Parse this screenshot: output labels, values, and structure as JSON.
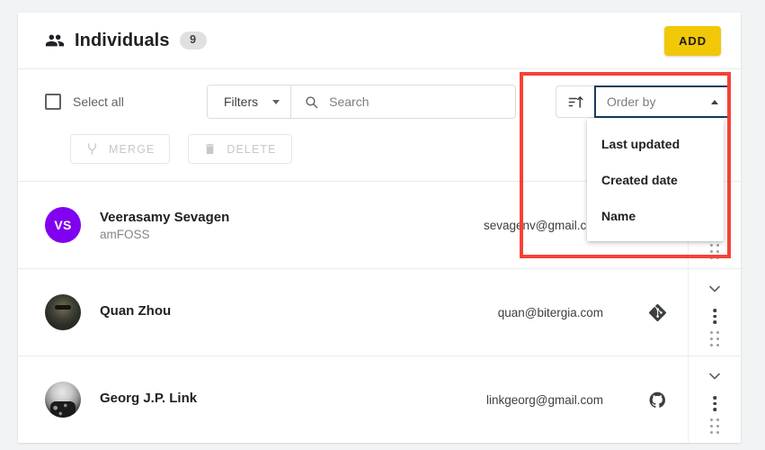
{
  "header": {
    "icon": "people-icon",
    "title": "Individuals",
    "count": "9",
    "add_label": "ADD"
  },
  "toolbar": {
    "select_all_label": "Select all",
    "select_all_checked": false,
    "filters_label": "Filters",
    "filters_caret": "chevron-down-icon",
    "search_icon": "search-icon",
    "search_value": "",
    "search_placeholder": "Search",
    "sort_direction_icon": "sort-ascending-icon",
    "order_by_placeholder": "Order by",
    "order_by_value": "",
    "order_caret": "chevron-up-icon",
    "order_menu_open": true,
    "order_menu_items": [
      {
        "label": "Last updated"
      },
      {
        "label": "Created date"
      },
      {
        "label": "Name"
      }
    ]
  },
  "actions": {
    "merge_label": "MERGE",
    "merge_icon": "merge-icon",
    "merge_disabled": true,
    "delete_label": "DELETE",
    "delete_icon": "trash-icon",
    "delete_disabled": true
  },
  "list": {
    "items": [
      {
        "name": "Veerasamy Sevagen",
        "organization": "amFOSS",
        "email": "sevagenv@gmail.com",
        "avatar_type": "initials",
        "avatar_initials": "VS",
        "avatar_color": "#8200f0",
        "source_icon": "",
        "expand_icon": "chevron-down-icon",
        "menu_icon": "kebab-menu-icon",
        "drag_icon": "drag-handle-icon"
      },
      {
        "name": "Quan Zhou",
        "organization": "",
        "email": "quan@bitergia.com",
        "avatar_type": "photo",
        "avatar_initials": "",
        "avatar_color": "#4b5a4c",
        "source_icon": "git-icon",
        "expand_icon": "chevron-down-icon",
        "menu_icon": "kebab-menu-icon",
        "drag_icon": "drag-handle-icon"
      },
      {
        "name": "Georg J.P. Link",
        "organization": "",
        "email": "linkgeorg@gmail.com",
        "avatar_type": "photo",
        "avatar_initials": "",
        "avatar_color": "#bdbdbd",
        "source_icon": "github-icon",
        "expand_icon": "chevron-down-icon",
        "menu_icon": "kebab-menu-icon",
        "drag_icon": "drag-handle-icon"
      }
    ]
  },
  "annotation": {
    "highlight_color": "#f44336",
    "target": "order-by-dropdown"
  },
  "colors": {
    "accent": "#f0c808",
    "focus_border": "#123c5e",
    "avatar_purple": "#8200f0",
    "page_background": "#f1f3f4",
    "card_background": "#ffffff"
  }
}
